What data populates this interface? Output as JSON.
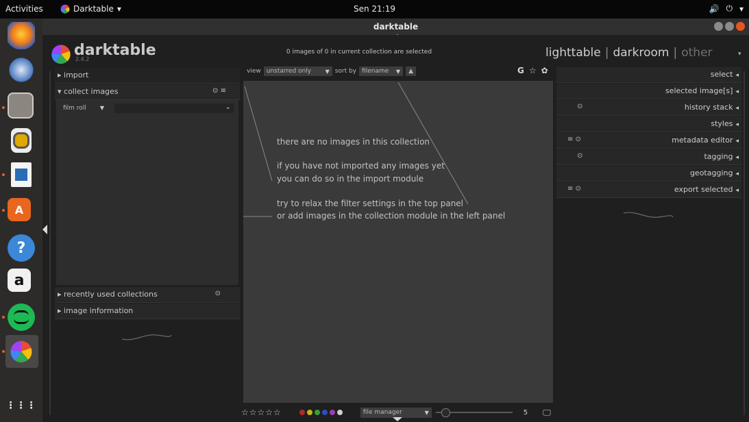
{
  "topbar": {
    "activities": "Activities",
    "app_menu": "Darktable",
    "clock": "Sen 21:19",
    "volume_icon": "🔊",
    "power_icon": "⏻",
    "menu_caret": "▾"
  },
  "dock": {
    "items": [
      "firefox",
      "thunderbird",
      "files",
      "rhythmbox",
      "libreoffice-writer",
      "software-center",
      "help",
      "amazon",
      "spotify",
      "darktable",
      "show-applications"
    ]
  },
  "window": {
    "title": "darktable"
  },
  "header": {
    "app_name": "darktable",
    "version": "2.4.2",
    "status": "0 images of 0 in current collection are selected",
    "views": {
      "lighttable": "lighttable",
      "darkroom": "darkroom",
      "other": "other"
    },
    "sep": "|"
  },
  "filterbar": {
    "view_label": "view",
    "view_value": "unstarred only",
    "sortby_label": "sort by",
    "sortby_value": "filename",
    "sort_dir": "▲",
    "g_label": "G",
    "star_label": "☆",
    "gear_label": "✿"
  },
  "left_panel": {
    "import": "import",
    "collect_images": "collect images",
    "film_roll": "film roll",
    "recent": "recently used collections",
    "image_info": "image information",
    "expand_collapsed": "▸",
    "expand_open": "▾",
    "reset_icon": "⊙",
    "presets_icon": "≡"
  },
  "center": {
    "line1": "there are no images in this collection",
    "line2": "if you have not imported any images yet",
    "line3": "you can do so in the import module",
    "line4": "try to relax the filter settings in the top panel",
    "line5": "or add images in the collection module in the left panel"
  },
  "bottom_bar": {
    "stars": "☆☆☆☆☆",
    "color_labels": [
      "#b02a2a",
      "#c7b321",
      "#3a9f3a",
      "#2a4fc4",
      "#9a3fb0",
      "#cfcfcf"
    ],
    "layout_value": "file manager",
    "zoom_value": "5",
    "zoom_fraction": 0.08,
    "display_icon": "🖵"
  },
  "right_panel": {
    "items": [
      {
        "label": "select",
        "icons": ""
      },
      {
        "label": "selected image[s]",
        "icons": ""
      },
      {
        "label": "history stack",
        "icons": "⊙"
      },
      {
        "label": "styles",
        "icons": ""
      },
      {
        "label": "metadata editor",
        "icons": "≡ ⊙"
      },
      {
        "label": "tagging",
        "icons": "⊙"
      },
      {
        "label": "geotagging",
        "icons": ""
      },
      {
        "label": "export selected",
        "icons": "≡ ⊙"
      }
    ],
    "collapse_arrow": "◂"
  }
}
